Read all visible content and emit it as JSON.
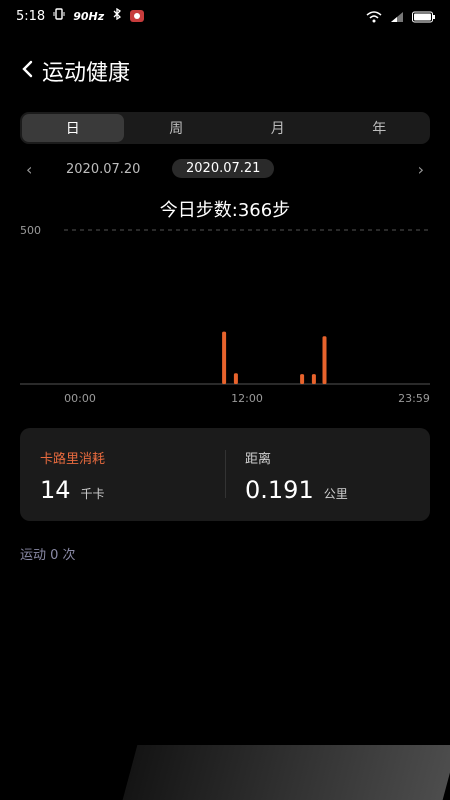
{
  "status": {
    "time": "5:18",
    "refresh_rate": "90Hz",
    "icons": [
      "vibrate-icon",
      "bluetooth-icon",
      "camera-icon",
      "wifi-icon",
      "signal-icon",
      "battery-icon"
    ]
  },
  "header": {
    "title": "运动健康"
  },
  "tabs": [
    {
      "label": "日",
      "active": true
    },
    {
      "label": "周",
      "active": false
    },
    {
      "label": "月",
      "active": false
    },
    {
      "label": "年",
      "active": false
    }
  ],
  "date_nav": {
    "prev_date": "2020.07.20",
    "current_date": "2020.07.21"
  },
  "summary": {
    "steps_text": "今日步数:366步"
  },
  "chart_data": {
    "type": "bar",
    "y_max_label": "500",
    "x_tick_labels": [
      "00:00",
      "12:00",
      "23:59"
    ],
    "bars": [
      {
        "time": "10:10",
        "value": 170
      },
      {
        "time": "11:00",
        "value": 35
      },
      {
        "time": "15:40",
        "value": 32
      },
      {
        "time": "16:30",
        "value": 32
      },
      {
        "time": "17:15",
        "value": 155
      }
    ],
    "color": "#e8632c",
    "grid": "top-dashed-line"
  },
  "metrics": {
    "calories": {
      "label": "卡路里消耗",
      "value": "14",
      "unit": "千卡"
    },
    "distance": {
      "label": "距离",
      "value": "0.191",
      "unit": "公里"
    }
  },
  "exercise_count": "运动 0 次",
  "colors": {
    "accent": "#e8632c",
    "card_bg": "#1b1b1b",
    "background": "#000000"
  }
}
